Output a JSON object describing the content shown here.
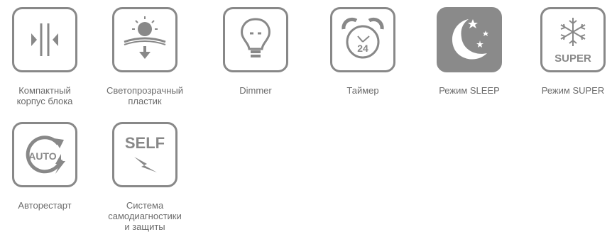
{
  "features": [
    {
      "id": "compact",
      "label": "Компактный\nкорпус блока",
      "icon": "compact-body-icon"
    },
    {
      "id": "translucent",
      "label": "Светопрозрачный\nпластик",
      "icon": "translucent-plastic-icon"
    },
    {
      "id": "dimmer",
      "label": "Dimmer",
      "icon": "dimmer-lightbulb-icon"
    },
    {
      "id": "timer",
      "label": "Таймер",
      "icon": "timer-alarm-clock-icon",
      "icon_text": "24"
    },
    {
      "id": "sleep",
      "label": "Режим SLEEP",
      "icon": "sleep-moon-icon"
    },
    {
      "id": "super",
      "label": "Режим SUPER",
      "icon": "super-snowflake-icon",
      "icon_text": "SUPER"
    },
    {
      "id": "autorestart",
      "label": "Авторестарт",
      "icon": "autorestart-icon",
      "icon_text": "AUTO"
    },
    {
      "id": "selfdiag",
      "label": "Система\nсамодиагностики\nи защиты",
      "icon": "self-diagnostics-icon",
      "icon_text": "SELF"
    }
  ],
  "colors": {
    "icon_gray": "#888888",
    "text_gray": "#6b6b6b"
  }
}
